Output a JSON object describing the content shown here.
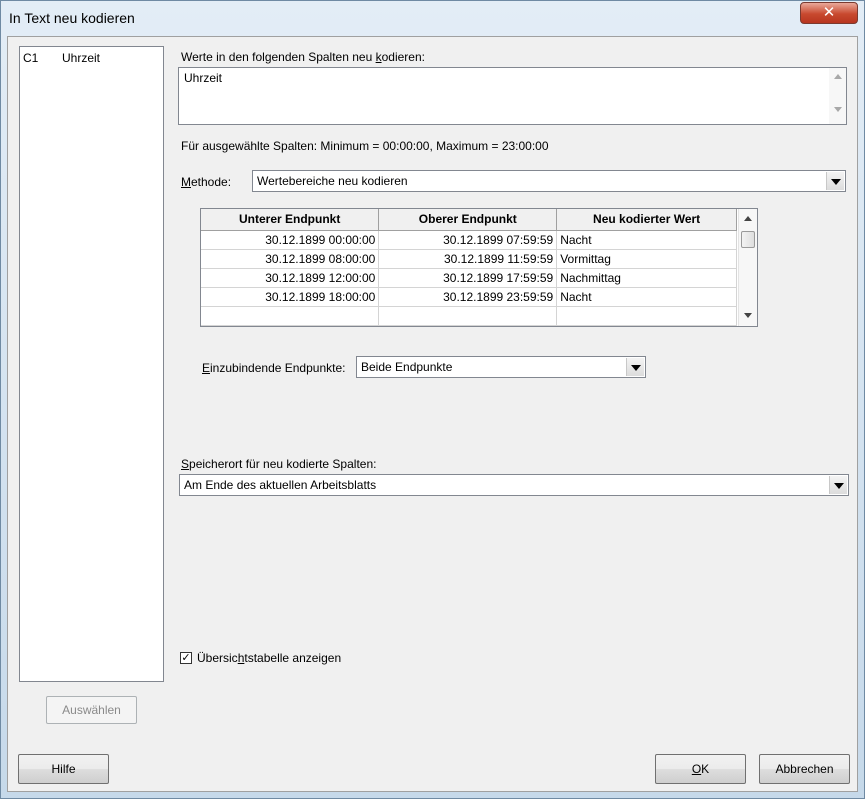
{
  "window": {
    "title": "In Text neu kodieren",
    "close_glyph": "✕"
  },
  "column_list": {
    "items": [
      {
        "col": "C1",
        "name": "Uhrzeit"
      }
    ]
  },
  "select_button": "Auswählen",
  "recode_columns": {
    "label": "Werte in den folgenden Spalten neu kodieren:",
    "value": "Uhrzeit"
  },
  "info_text": "Für ausgewählte Spalten: Minimum = 00:00:00, Maximum = 23:00:00",
  "method": {
    "label": "Methode:",
    "value": "Wertebereiche neu kodieren"
  },
  "table": {
    "headers": [
      "Unterer Endpunkt",
      "Oberer Endpunkt",
      "Neu kodierter Wert"
    ],
    "rows": [
      [
        "30.12.1899 00:00:00",
        "30.12.1899 07:59:59",
        "Nacht"
      ],
      [
        "30.12.1899 08:00:00",
        "30.12.1899 11:59:59",
        "Vormittag"
      ],
      [
        "30.12.1899 12:00:00",
        "30.12.1899 17:59:59",
        "Nachmittag"
      ],
      [
        "30.12.1899 18:00:00",
        "30.12.1899 23:59:59",
        "Nacht"
      ],
      [
        "",
        "",
        ""
      ]
    ]
  },
  "endpoints": {
    "label": "Einzubindende Endpunkte:",
    "value": "Beide Endpunkte"
  },
  "storage": {
    "label": "Speicherort für neu kodierte Spalten:",
    "value": "Am Ende des aktuellen Arbeitsblatts"
  },
  "summary_checkbox": {
    "label": "Übersichtstabelle anzeigen",
    "checked": true,
    "check_glyph": "✓"
  },
  "buttons": {
    "help": "Hilfe",
    "ok": "OK",
    "cancel": "Abbrechen"
  }
}
